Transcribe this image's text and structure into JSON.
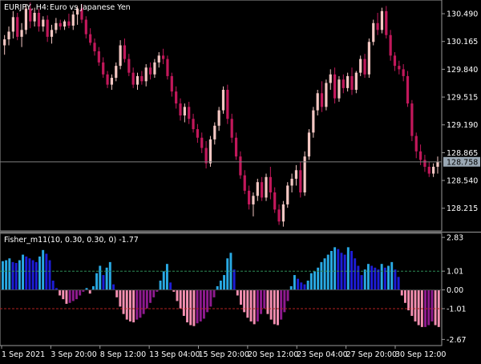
{
  "header": {
    "symbol": "EURJPY, H4:",
    "description": "Euro vs Japanese Yen"
  },
  "indicator": {
    "label": "Fisher_m11(10, 0.30, 0.30, 0) -1.77"
  },
  "colors": {
    "background": "#000000",
    "frame": "#9a9a9a",
    "bull_candle": "#f4c7c3",
    "bear_candle": "#c2185b",
    "bid_line": "#808080",
    "bid_box": "#9aa8b4",
    "hist_pos_strong": "#29a9e3",
    "hist_pos_weak": "#1d1dd6",
    "hist_neg_strong": "#f48fb1",
    "hist_neg_weak": "#8e1a8e",
    "level_pos": "#2e8b57",
    "level_neg": "#b22222"
  },
  "chart_data": [
    {
      "type": "candlestick",
      "title": "EURJPY, H4: Euro vs Japanese Yen",
      "ylim": [
        127.95,
        130.65
      ],
      "y_ticks": [
        "130.490",
        "130.165",
        "129.840",
        "129.515",
        "129.190",
        "128.865",
        "128.540",
        "128.215"
      ],
      "y_tick_values": [
        130.49,
        130.165,
        129.84,
        129.515,
        129.19,
        128.865,
        128.54,
        128.215
      ],
      "current_price": "128.758",
      "current_price_value": 128.758,
      "candles": [
        [
          130.12,
          130.24,
          130.01,
          130.19
        ],
        [
          130.19,
          130.34,
          130.12,
          130.28
        ],
        [
          130.28,
          130.52,
          130.2,
          130.45
        ],
        [
          130.45,
          130.5,
          130.18,
          130.22
        ],
        [
          130.22,
          130.38,
          130.1,
          130.3
        ],
        [
          130.3,
          130.6,
          130.25,
          130.55
        ],
        [
          130.55,
          130.62,
          130.32,
          130.4
        ],
        [
          130.4,
          130.56,
          130.34,
          130.5
        ],
        [
          130.5,
          130.55,
          130.28,
          130.34
        ],
        [
          130.34,
          130.46,
          130.28,
          130.42
        ],
        [
          130.42,
          130.47,
          130.16,
          130.22
        ],
        [
          130.22,
          130.36,
          130.14,
          130.3
        ],
        [
          130.3,
          130.44,
          130.26,
          130.38
        ],
        [
          130.38,
          130.42,
          130.3,
          130.34
        ],
        [
          130.34,
          130.42,
          130.3,
          130.4
        ],
        [
          130.4,
          130.49,
          130.32,
          130.35
        ],
        [
          130.35,
          130.52,
          130.3,
          130.48
        ],
        [
          130.48,
          130.58,
          130.36,
          130.55
        ],
        [
          130.55,
          130.6,
          130.38,
          130.42
        ],
        [
          130.42,
          130.46,
          130.2,
          130.25
        ],
        [
          130.25,
          130.32,
          130.12,
          130.15
        ],
        [
          130.15,
          130.2,
          130.0,
          130.05
        ],
        [
          130.05,
          130.1,
          129.88,
          129.92
        ],
        [
          129.92,
          129.98,
          129.74,
          129.78
        ],
        [
          129.78,
          129.82,
          129.62,
          129.66
        ],
        [
          129.66,
          129.78,
          129.6,
          129.74
        ],
        [
          129.74,
          129.92,
          129.7,
          129.88
        ],
        [
          129.88,
          130.18,
          129.84,
          130.12
        ],
        [
          130.12,
          130.2,
          129.92,
          129.96
        ],
        [
          129.96,
          130.02,
          129.76,
          129.8
        ],
        [
          129.8,
          129.86,
          129.62,
          129.66
        ],
        [
          129.66,
          129.8,
          129.6,
          129.76
        ],
        [
          129.76,
          129.82,
          129.66,
          129.7
        ],
        [
          129.7,
          129.9,
          129.64,
          129.86
        ],
        [
          129.86,
          129.92,
          129.72,
          129.78
        ],
        [
          129.78,
          129.96,
          129.74,
          129.92
        ],
        [
          129.92,
          130.04,
          129.86,
          130.0
        ],
        [
          130.0,
          130.08,
          129.9,
          129.96
        ],
        [
          129.96,
          130.0,
          129.72,
          129.76
        ],
        [
          129.76,
          129.8,
          129.52,
          129.58
        ],
        [
          129.58,
          129.64,
          129.38,
          129.44
        ],
        [
          129.44,
          129.5,
          129.24,
          129.3
        ],
        [
          129.3,
          129.44,
          129.22,
          129.4
        ],
        [
          129.4,
          129.46,
          129.2,
          129.26
        ],
        [
          129.26,
          129.32,
          129.1,
          129.14
        ],
        [
          129.14,
          129.2,
          128.98,
          129.04
        ],
        [
          129.04,
          129.1,
          128.86,
          128.92
        ],
        [
          128.92,
          129.0,
          128.68,
          128.74
        ],
        [
          128.74,
          129.06,
          128.7,
          129.02
        ],
        [
          129.02,
          129.22,
          128.96,
          129.18
        ],
        [
          129.18,
          129.4,
          129.12,
          129.36
        ],
        [
          129.36,
          129.64,
          129.32,
          129.6
        ],
        [
          129.6,
          129.66,
          129.2,
          129.26
        ],
        [
          129.26,
          129.32,
          128.98,
          129.04
        ],
        [
          129.04,
          129.1,
          128.78,
          128.82
        ],
        [
          128.82,
          128.88,
          128.56,
          128.6
        ],
        [
          128.6,
          128.66,
          128.38,
          128.42
        ],
        [
          128.42,
          128.48,
          128.2,
          128.26
        ],
        [
          128.26,
          128.4,
          128.12,
          128.36
        ],
        [
          128.36,
          128.56,
          128.3,
          128.52
        ],
        [
          128.52,
          128.58,
          128.3,
          128.34
        ],
        [
          128.34,
          128.62,
          128.3,
          128.58
        ],
        [
          128.58,
          128.7,
          128.32,
          128.4
        ],
        [
          128.4,
          128.46,
          128.16,
          128.2
        ],
        [
          128.2,
          128.26,
          128.02,
          128.06
        ],
        [
          128.06,
          128.3,
          128.0,
          128.26
        ],
        [
          128.26,
          128.52,
          128.22,
          128.48
        ],
        [
          128.48,
          128.62,
          128.4,
          128.56
        ],
        [
          128.56,
          128.72,
          128.48,
          128.66
        ],
        [
          128.66,
          128.76,
          128.34,
          128.4
        ],
        [
          128.4,
          128.88,
          128.36,
          128.82
        ],
        [
          128.82,
          129.14,
          128.78,
          129.1
        ],
        [
          129.1,
          129.4,
          129.04,
          129.36
        ],
        [
          129.36,
          129.6,
          129.3,
          129.56
        ],
        [
          129.56,
          129.7,
          129.34,
          129.4
        ],
        [
          129.4,
          129.72,
          129.36,
          129.68
        ],
        [
          129.68,
          129.84,
          129.6,
          129.78
        ],
        [
          129.78,
          129.86,
          129.44,
          129.5
        ],
        [
          129.5,
          129.76,
          129.46,
          129.72
        ],
        [
          129.72,
          129.78,
          129.56,
          129.62
        ],
        [
          129.62,
          129.8,
          129.58,
          129.76
        ],
        [
          129.76,
          129.86,
          129.54,
          129.6
        ],
        [
          129.6,
          129.82,
          129.56,
          129.8
        ],
        [
          129.8,
          130.0,
          129.76,
          129.96
        ],
        [
          129.96,
          130.02,
          129.74,
          129.78
        ],
        [
          129.78,
          130.2,
          129.74,
          130.16
        ],
        [
          130.16,
          130.42,
          130.12,
          130.38
        ],
        [
          130.38,
          130.5,
          130.24,
          130.3
        ],
        [
          130.3,
          130.56,
          130.26,
          130.52
        ],
        [
          130.52,
          130.58,
          130.2,
          130.24
        ],
        [
          130.24,
          130.3,
          129.94,
          130.0
        ],
        [
          130.0,
          130.04,
          129.82,
          129.88
        ],
        [
          129.88,
          129.94,
          129.78,
          129.84
        ],
        [
          129.84,
          129.9,
          129.7,
          129.76
        ],
        [
          129.76,
          129.82,
          129.4,
          129.44
        ],
        [
          129.44,
          129.48,
          129.0,
          129.06
        ],
        [
          129.06,
          129.1,
          128.8,
          128.88
        ],
        [
          128.88,
          128.96,
          128.72,
          128.78
        ],
        [
          128.78,
          128.84,
          128.64,
          128.7
        ],
        [
          128.7,
          128.76,
          128.58,
          128.62
        ],
        [
          128.62,
          128.74,
          128.58,
          128.7
        ],
        [
          128.7,
          128.82,
          128.62,
          128.758
        ]
      ]
    },
    {
      "type": "bar",
      "title": "Fisher_m11(10, 0.30, 0.30, 0) -1.77",
      "ylim": [
        -3.0,
        3.05
      ],
      "y_ticks": [
        "2.83",
        "1.01",
        "0.00",
        "-1.01",
        "-2.67"
      ],
      "y_tick_values": [
        2.83,
        1.01,
        0.0,
        -1.01,
        -2.67
      ],
      "levels": [
        1.01,
        -1.01
      ],
      "values": [
        1.55,
        1.6,
        1.7,
        1.5,
        1.45,
        1.6,
        1.9,
        1.8,
        1.7,
        1.6,
        1.5,
        1.8,
        2.15,
        1.95,
        1.6,
        0.5,
        0.1,
        -0.3,
        -0.5,
        -0.75,
        -0.7,
        -0.6,
        -0.5,
        -0.3,
        -0.1,
        0.1,
        -0.2,
        0.2,
        0.9,
        1.3,
        0.8,
        1.2,
        1.5,
        0.3,
        -0.4,
        -0.9,
        -1.3,
        -1.6,
        -1.7,
        -1.75,
        -1.6,
        -1.5,
        -1.3,
        -1.0,
        -0.7,
        -0.4,
        -0.1,
        0.5,
        1.0,
        1.4,
        0.4,
        -0.1,
        -0.6,
        -1.0,
        -1.4,
        -1.75,
        -1.9,
        -1.95,
        -1.8,
        -1.7,
        -1.55,
        -1.2,
        -0.9,
        -0.4,
        0.2,
        0.5,
        0.8,
        1.7,
        2.0,
        1.1,
        -0.3,
        -0.8,
        -1.2,
        -1.5,
        -1.7,
        -1.85,
        -1.7,
        -1.3,
        -1.0,
        -1.3,
        -1.6,
        -1.85,
        -1.9,
        -1.6,
        -1.2,
        -0.6,
        0.2,
        0.8,
        0.6,
        0.4,
        0.3,
        0.5,
        0.9,
        1.0,
        1.2,
        1.5,
        1.7,
        1.9,
        2.1,
        2.3,
        2.2,
        2.0,
        1.9,
        2.3,
        2.1,
        1.7,
        1.3,
        0.8,
        1.1,
        1.4,
        1.3,
        1.2,
        1.1,
        1.4,
        1.2,
        1.3,
        1.5,
        1.1,
        0.7,
        -0.3,
        -0.7,
        -1.1,
        -1.4,
        -1.7,
        -1.9,
        -2.0,
        -2.0,
        -1.9,
        -1.7,
        -1.9,
        -2.0
      ],
      "x_tick_labels": [
        "1 Sep 2021",
        "3 Sep 20:00",
        "8 Sep 12:00",
        "13 Sep 04:00",
        "15 Sep 20:00",
        "20 Sep 12:00",
        "23 Sep 04:00",
        "27 Sep 20:00",
        "30 Sep 12:00"
      ]
    }
  ]
}
